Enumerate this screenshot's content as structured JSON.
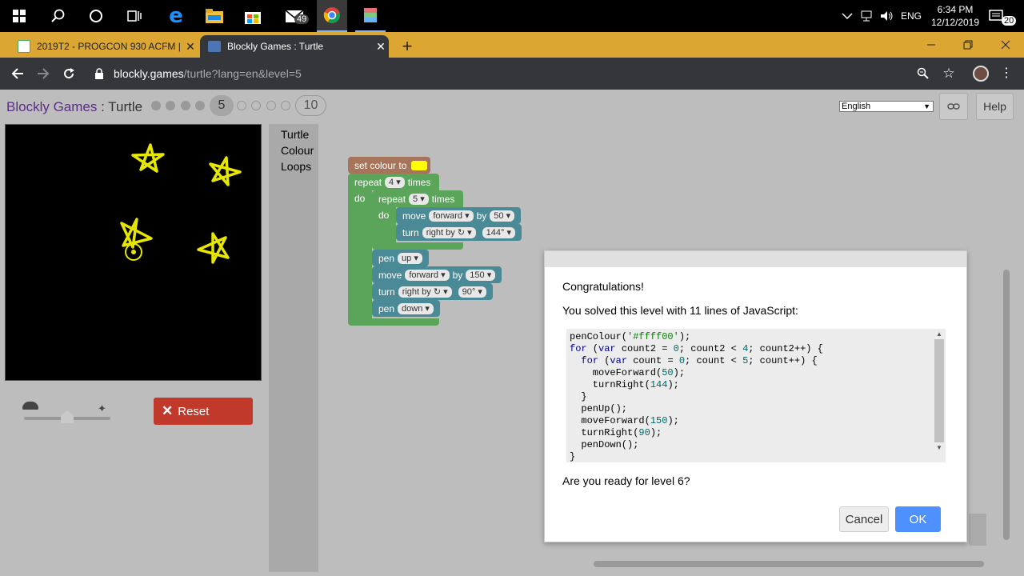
{
  "taskbar": {
    "mail_badge": "49",
    "language": "ENG",
    "time": "6:34 PM",
    "date": "12/12/2019",
    "notifications_badge": "20"
  },
  "tabs": [
    {
      "title": "2019T2 - PROGCON 930 ACFM |"
    },
    {
      "title": "Blockly Games : Turtle"
    }
  ],
  "address": {
    "host": "blockly.games",
    "path": "/turtle?lang=en&level=5"
  },
  "header": {
    "app_name": "Blockly Games",
    "separator": ":",
    "game_name": "Turtle",
    "current_level": "5",
    "max_level": "10",
    "language_selected": "English",
    "help_label": "Help"
  },
  "toolbox": {
    "items": [
      "Turtle",
      "Colour",
      "Loops"
    ]
  },
  "blocks": {
    "set_colour": "set colour to",
    "colour_value": "#ffff00",
    "repeat_outer": "repeat",
    "repeat_outer_n": "4",
    "times_outer": "times",
    "do_outer": "do",
    "repeat_inner": "repeat",
    "repeat_inner_n": "5",
    "times_inner": "times",
    "do_inner": "do",
    "move_label": "move",
    "move_dir": "forward",
    "by_label": "by",
    "move_value": "50",
    "turn_label": "turn",
    "turn_dir": "right by ↻",
    "turn_value": "144°",
    "pen_label": "pen",
    "pen_up": "up",
    "move2_label": "move",
    "move2_dir": "forward",
    "by2_label": "by",
    "move2_value": "150",
    "turn2_label": "turn",
    "turn2_dir": "right by ↻",
    "turn2_value": "90°",
    "pen2_label": "pen",
    "pen_down": "down"
  },
  "speed": {
    "reset_label": "Reset"
  },
  "dialog": {
    "heading": "Congratulations!",
    "message": "You solved this level with 11 lines of JavaScript:",
    "question": "Are you ready for level 6?",
    "cancel_label": "Cancel",
    "ok_label": "OK",
    "code_lines": [
      "penColour('#ffff00');",
      "for (var count2 = 0; count2 < 4; count2++) {",
      "  for (var count = 0; count < 5; count++) {",
      "    moveForward(50);",
      "    turnRight(144);",
      "  }",
      "  penUp();",
      "  moveForward(150);",
      "  turnRight(90);",
      "  penDown();",
      "}"
    ]
  }
}
